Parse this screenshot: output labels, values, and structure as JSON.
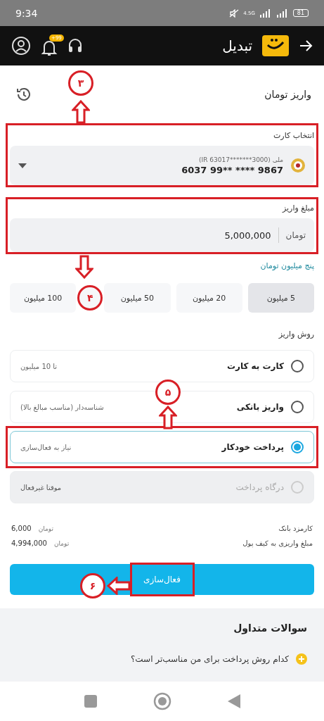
{
  "status_bar": {
    "time": "9:34",
    "network": "4.5G",
    "battery": "81"
  },
  "header": {
    "logo_text": "تبدیل",
    "notification_badge": "99+"
  },
  "page": {
    "title": "واریز تومان"
  },
  "card_select": {
    "label": "انتخاب کارت",
    "bank_line": "ملی (IR 63017*******3000)",
    "card_number": "6037 99** **** 9867"
  },
  "amount": {
    "label": "مبلغ واریز",
    "value": "5,000,000",
    "unit": "تومان",
    "in_words": "پنج میلیون تومان"
  },
  "presets": [
    {
      "label": "5 میلیون",
      "selected": true
    },
    {
      "label": "20 میلیون",
      "selected": false
    },
    {
      "label": "50 میلیون",
      "selected": false
    },
    {
      "label": "100 میلیون",
      "selected": false
    }
  ],
  "method": {
    "label": "روش واریز",
    "options": [
      {
        "title": "کارت به کارت",
        "note": "تا 10 میلیون",
        "selected": false,
        "disabled": false
      },
      {
        "title": "واریز بانکی",
        "note": "شناسه‌دار (مناسب مبالغ بالا)",
        "selected": false,
        "disabled": false
      },
      {
        "title": "پرداخت خودکار",
        "note": "نیاز به فعال‌سازی",
        "selected": true,
        "disabled": false
      },
      {
        "title": "درگاه پرداخت",
        "note": "موقتا غیرفعال",
        "selected": false,
        "disabled": true
      }
    ]
  },
  "summary": [
    {
      "label": "کارمزد بانک",
      "unit": "تومان",
      "value": "6,000"
    },
    {
      "label": "مبلغ واریزی به کیف پول",
      "unit": "تومان",
      "value": "4,994,000"
    }
  ],
  "submit_button": "فعال‌سازی",
  "faq": {
    "title": "سوالات متداول",
    "questions": [
      "کدام روش پرداخت برای من مناسب‌تر است؟"
    ]
  },
  "annotations": [
    {
      "number": "۳"
    },
    {
      "number": "۴"
    },
    {
      "number": "۵"
    },
    {
      "number": "۶"
    }
  ]
}
